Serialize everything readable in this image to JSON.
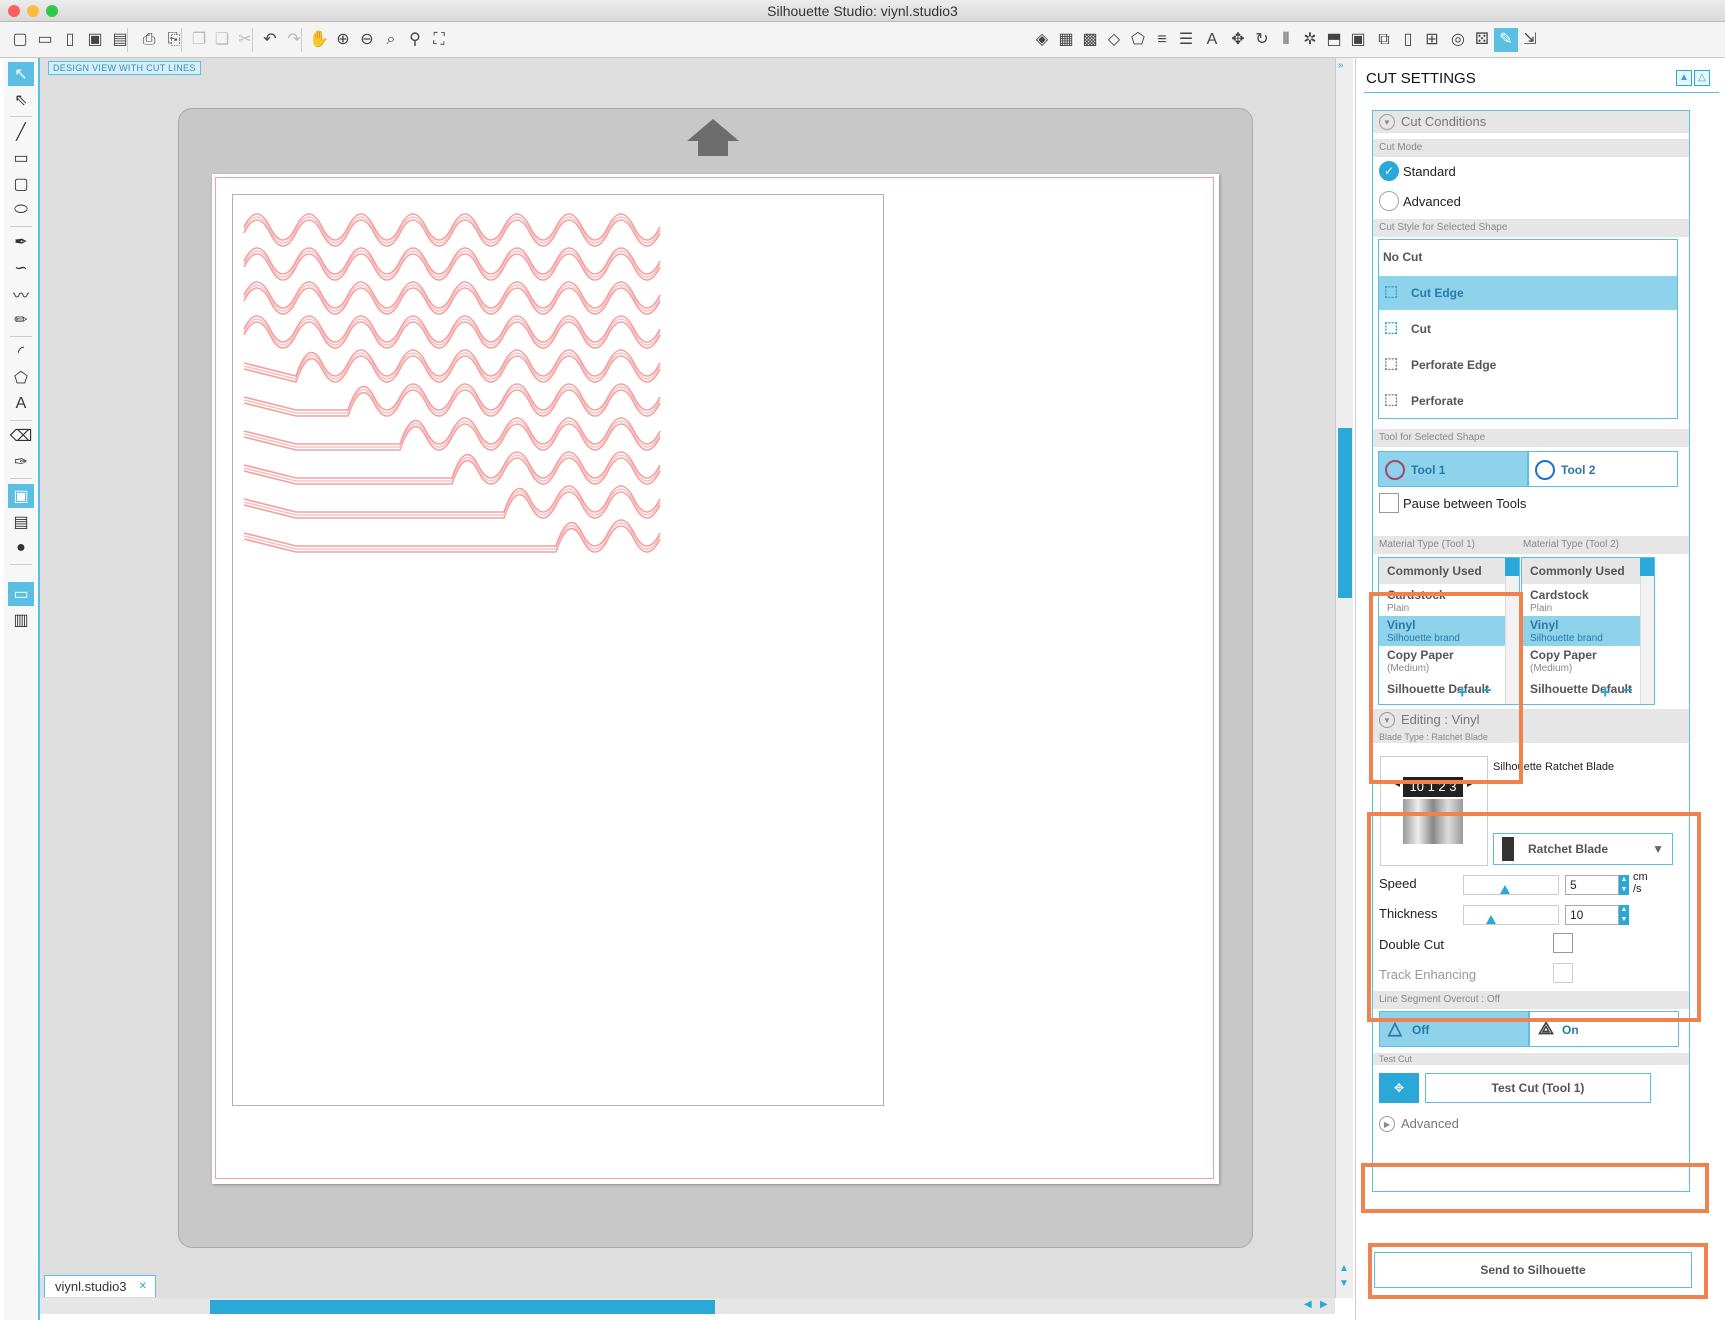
{
  "window": {
    "title": "Silhouette Studio: viynl.studio3"
  },
  "canvas": {
    "view_label": "DESIGN VIEW WITH CUT LINES",
    "document_tab": "viynl.studio3"
  },
  "panel": {
    "title": "CUT SETTINGS",
    "cut_conditions": {
      "header": "Cut Conditions",
      "cut_mode_label": "Cut Mode",
      "standard": "Standard",
      "advanced": "Advanced",
      "selected_mode": "Standard"
    },
    "cut_style": {
      "label": "Cut Style for Selected Shape",
      "items": [
        "No Cut",
        "Cut Edge",
        "Cut",
        "Perforate Edge",
        "Perforate"
      ],
      "selected": "Cut Edge"
    },
    "tool": {
      "label": "Tool for Selected Shape",
      "tool1": "Tool 1",
      "tool2": "Tool 2",
      "pause": "Pause between Tools"
    },
    "material": {
      "label1": "Material Type (Tool 1)",
      "label2": "Material Type (Tool 2)",
      "header": "Commonly Used",
      "items": [
        {
          "name": "Cardstock",
          "sub": "Plain"
        },
        {
          "name": "Vinyl",
          "sub": "Silhouette brand"
        },
        {
          "name": "Copy Paper",
          "sub": "(Medium)"
        },
        {
          "name": "Silhouette Default",
          "sub": ""
        }
      ],
      "add": "+",
      "remove": "−"
    },
    "editing": {
      "header": "Editing : Vinyl",
      "blade_label": "Blade Type : Ratchet Blade",
      "blade_name": "Silhouette Ratchet Blade",
      "blade_digits": "10 1 2 3",
      "blade_select": "Ratchet Blade",
      "speed_label": "Speed",
      "speed_value": "5",
      "speed_unit": "cm /s",
      "speed_level": 0.45,
      "thickness_label": "Thickness",
      "thickness_value": "10",
      "thickness_level": 0.3,
      "double_cut": "Double Cut",
      "track_enhancing": "Track Enhancing"
    },
    "overcut": {
      "label": "Line Segment Overcut : Off",
      "off": "Off",
      "on": "On"
    },
    "test_cut": {
      "label": "Test Cut",
      "button": "Test Cut (Tool 1)"
    },
    "advanced_header": "Advanced",
    "send": "Send to Silhouette"
  },
  "colors": {
    "accent": "#2aa8d8",
    "cut_line": "#f4a0a0",
    "highlight": "#f0824f"
  },
  "icons": [
    "new-icon",
    "open-icon",
    "save-icon",
    "print-icon",
    "undo-icon",
    "redo-icon",
    "pan-icon",
    "zoom-in-icon",
    "zoom-out-icon",
    "fit-icon",
    "select-icon",
    "line-icon",
    "rectangle-icon",
    "ellipse-icon",
    "polygon-icon",
    "text-icon",
    "eraser-icon",
    "knife-icon"
  ]
}
